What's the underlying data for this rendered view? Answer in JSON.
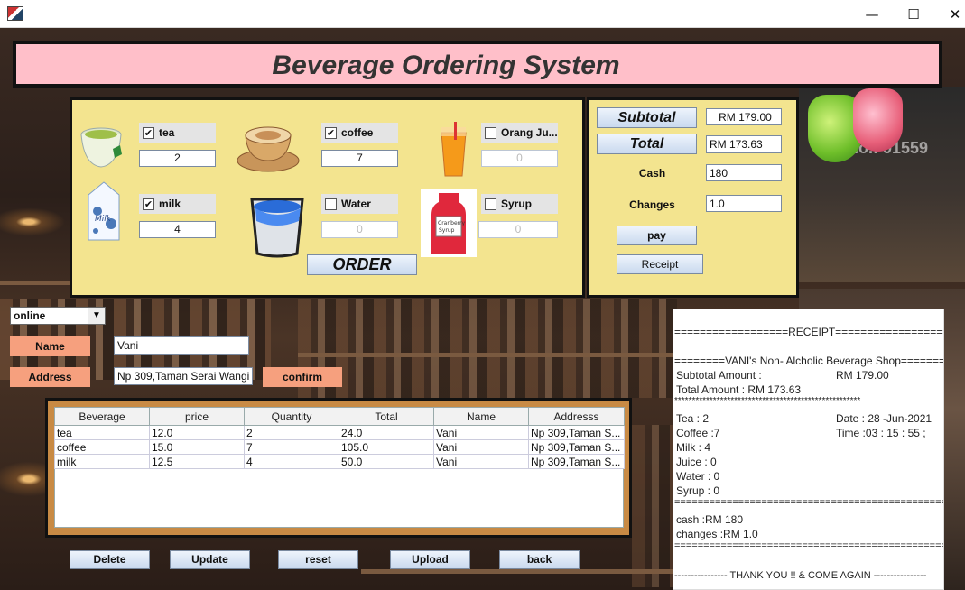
{
  "window": {
    "minimize": "—",
    "maximize": "☐",
    "close": "✕"
  },
  "app": {
    "title": "Beverage Ordering System"
  },
  "items": [
    {
      "label": "tea",
      "checked": true,
      "qty": "2",
      "enabled": true
    },
    {
      "label": "coffee",
      "checked": true,
      "qty": "7",
      "enabled": true
    },
    {
      "label": "Orang Ju...",
      "checked": false,
      "qty": "0",
      "enabled": false
    },
    {
      "label": "milk",
      "checked": true,
      "qty": "4",
      "enabled": true
    },
    {
      "label": "Water",
      "checked": false,
      "qty": "0",
      "enabled": false
    },
    {
      "label": "Syrup",
      "checked": false,
      "qty": "0",
      "enabled": false
    }
  ],
  "order_button": "ORDER",
  "totals": {
    "subtotal_label": "Subtotal",
    "subtotal_value": "RM 179.00",
    "total_label": "Total",
    "total_value": "RM 173.63",
    "cash_label": "Cash",
    "cash_value": "180",
    "changes_label": "Changes",
    "changes_value": "1.0",
    "pay_label": "pay",
    "receipt_label": "Receipt"
  },
  "customer": {
    "mode_selected": "online",
    "name_label": "Name",
    "name_value": "Vani",
    "address_label": "Address",
    "address_value": "Np 309,Taman Serai Wangi",
    "confirm_label": "confirm"
  },
  "table": {
    "headers": [
      "Beverage",
      "price",
      "Quantity",
      "Total",
      "Name",
      "Addresss"
    ],
    "rows": [
      [
        "tea",
        "12.0",
        "2",
        "24.0",
        "Vani",
        "Np 309,Taman S..."
      ],
      [
        "coffee",
        "15.0",
        "7",
        "105.0",
        "Vani",
        "Np 309,Taman S..."
      ],
      [
        "milk",
        "12.5",
        "4",
        "50.0",
        "Vani",
        "Np 309,Taman S..."
      ]
    ]
  },
  "actions": {
    "delete": "Delete",
    "update": "Update",
    "reset": "reset",
    "upload": "Upload",
    "back": "back"
  },
  "receipt": {
    "line1": "==================RECEIPT==================",
    "line2": "========VANI's Non- Alcholic Beverage Shop=======",
    "subtotal": "Subtotal Amount :",
    "subtotal_val": "RM 179.00",
    "total": "Total Amount :  RM 173.63",
    "stars": "*****************************************************",
    "tea": "Tea : 2",
    "coffee": "Coffee :7",
    "milk": "Milk : 4",
    "juice": "Juice : 0",
    "water": "Water : 0",
    "syrup": "Syrup : 0",
    "date": "Date : 28 -Jun-2021",
    "time": "Time :03 : 15 : 55 ;",
    "sep1": "================================================",
    "cash": "cash :RM 180",
    "changes": "changes :RM 1.0",
    "sep2": "================================================",
    "thanks": "---------------- THANK YOU !! & COME AGAIN ----------------"
  },
  "background": {
    "store_text": "ore No.: 91559"
  },
  "colors": {
    "panel": "#f3e48f",
    "title_bar": "#ffbfc9",
    "orange_button": "#f6a07e",
    "table_frame": "#c88a44"
  }
}
